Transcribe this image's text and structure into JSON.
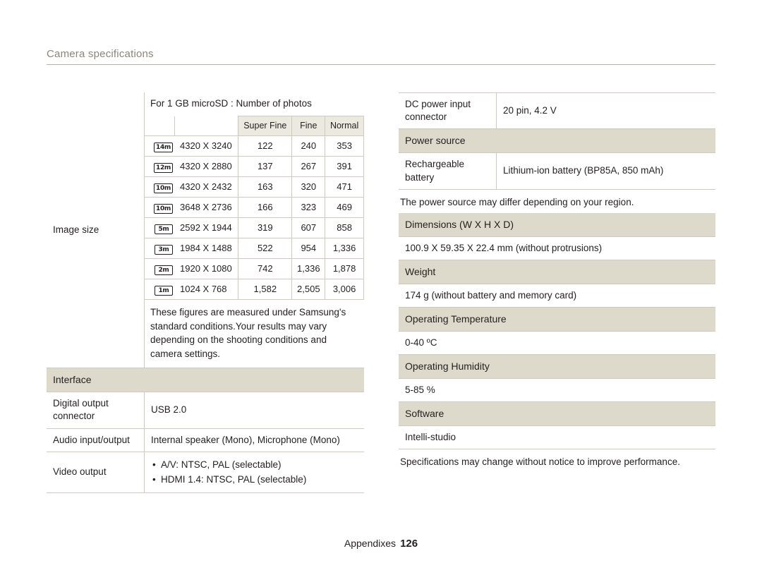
{
  "header": {
    "title": "Camera specifications"
  },
  "left": {
    "image_size": {
      "label": "Image size",
      "card_title": "For 1 GB microSD : Number of photos",
      "columns": [
        "Super Fine",
        "Fine",
        "Normal"
      ],
      "rows": [
        {
          "icon": "14m",
          "resolution": "4320 X 3240",
          "superfine": "122",
          "fine": "240",
          "normal": "353"
        },
        {
          "icon": "12m",
          "resolution": "4320 X 2880",
          "superfine": "137",
          "fine": "267",
          "normal": "391"
        },
        {
          "icon": "10m",
          "resolution": "4320 X 2432",
          "superfine": "163",
          "fine": "320",
          "normal": "471"
        },
        {
          "icon": "10m",
          "resolution": "3648 X 2736",
          "superfine": "166",
          "fine": "323",
          "normal": "469"
        },
        {
          "icon": "5m",
          "resolution": "2592 X 1944",
          "superfine": "319",
          "fine": "607",
          "normal": "858"
        },
        {
          "icon": "3m",
          "resolution": "1984 X 1488",
          "superfine": "522",
          "fine": "954",
          "normal": "1,336"
        },
        {
          "icon": "2m",
          "resolution": "1920 X 1080",
          "superfine": "742",
          "fine": "1,336",
          "normal": "1,878"
        },
        {
          "icon": "1m",
          "resolution": "1024 X 768",
          "superfine": "1,582",
          "fine": "2,505",
          "normal": "3,006"
        }
      ],
      "figures_note": "These figures are measured under Samsung's standard conditions.Your results may vary depending on the shooting conditions and camera settings."
    },
    "interface": {
      "section": "Interface",
      "rows": [
        {
          "label": "Digital output connector",
          "value": "USB 2.0"
        },
        {
          "label": "Audio input/output",
          "value": "Internal speaker (Mono), Microphone (Mono)"
        }
      ],
      "video_output": {
        "label": "Video output",
        "items": [
          "A/V: NTSC, PAL (selectable)",
          "HDMI 1.4: NTSC, PAL (selectable)"
        ]
      }
    }
  },
  "right": {
    "dc_power": {
      "label": "DC power input connector",
      "value": "20 pin, 4.2 V"
    },
    "power_source": {
      "section": "Power source",
      "label": "Rechargeable battery",
      "value": "Lithium-ion battery (BP85A, 850 mAh)",
      "note": "The power source may differ depending on your region."
    },
    "dimensions": {
      "section": "Dimensions (W X H X D)",
      "value": "100.9 X 59.35 X 22.4 mm (without protrusions)"
    },
    "weight": {
      "section": "Weight",
      "value": "174 g (without battery and memory card)"
    },
    "operating_temperature": {
      "section": "Operating Temperature",
      "value": "0-40 ºC"
    },
    "operating_humidity": {
      "section": "Operating Humidity",
      "value": "5-85 %"
    },
    "software": {
      "section": "Software",
      "value": "Intelli-studio"
    },
    "closing_note": "Specifications may change without notice to improve performance."
  },
  "footer": {
    "label": "Appendixes",
    "page": "126"
  }
}
